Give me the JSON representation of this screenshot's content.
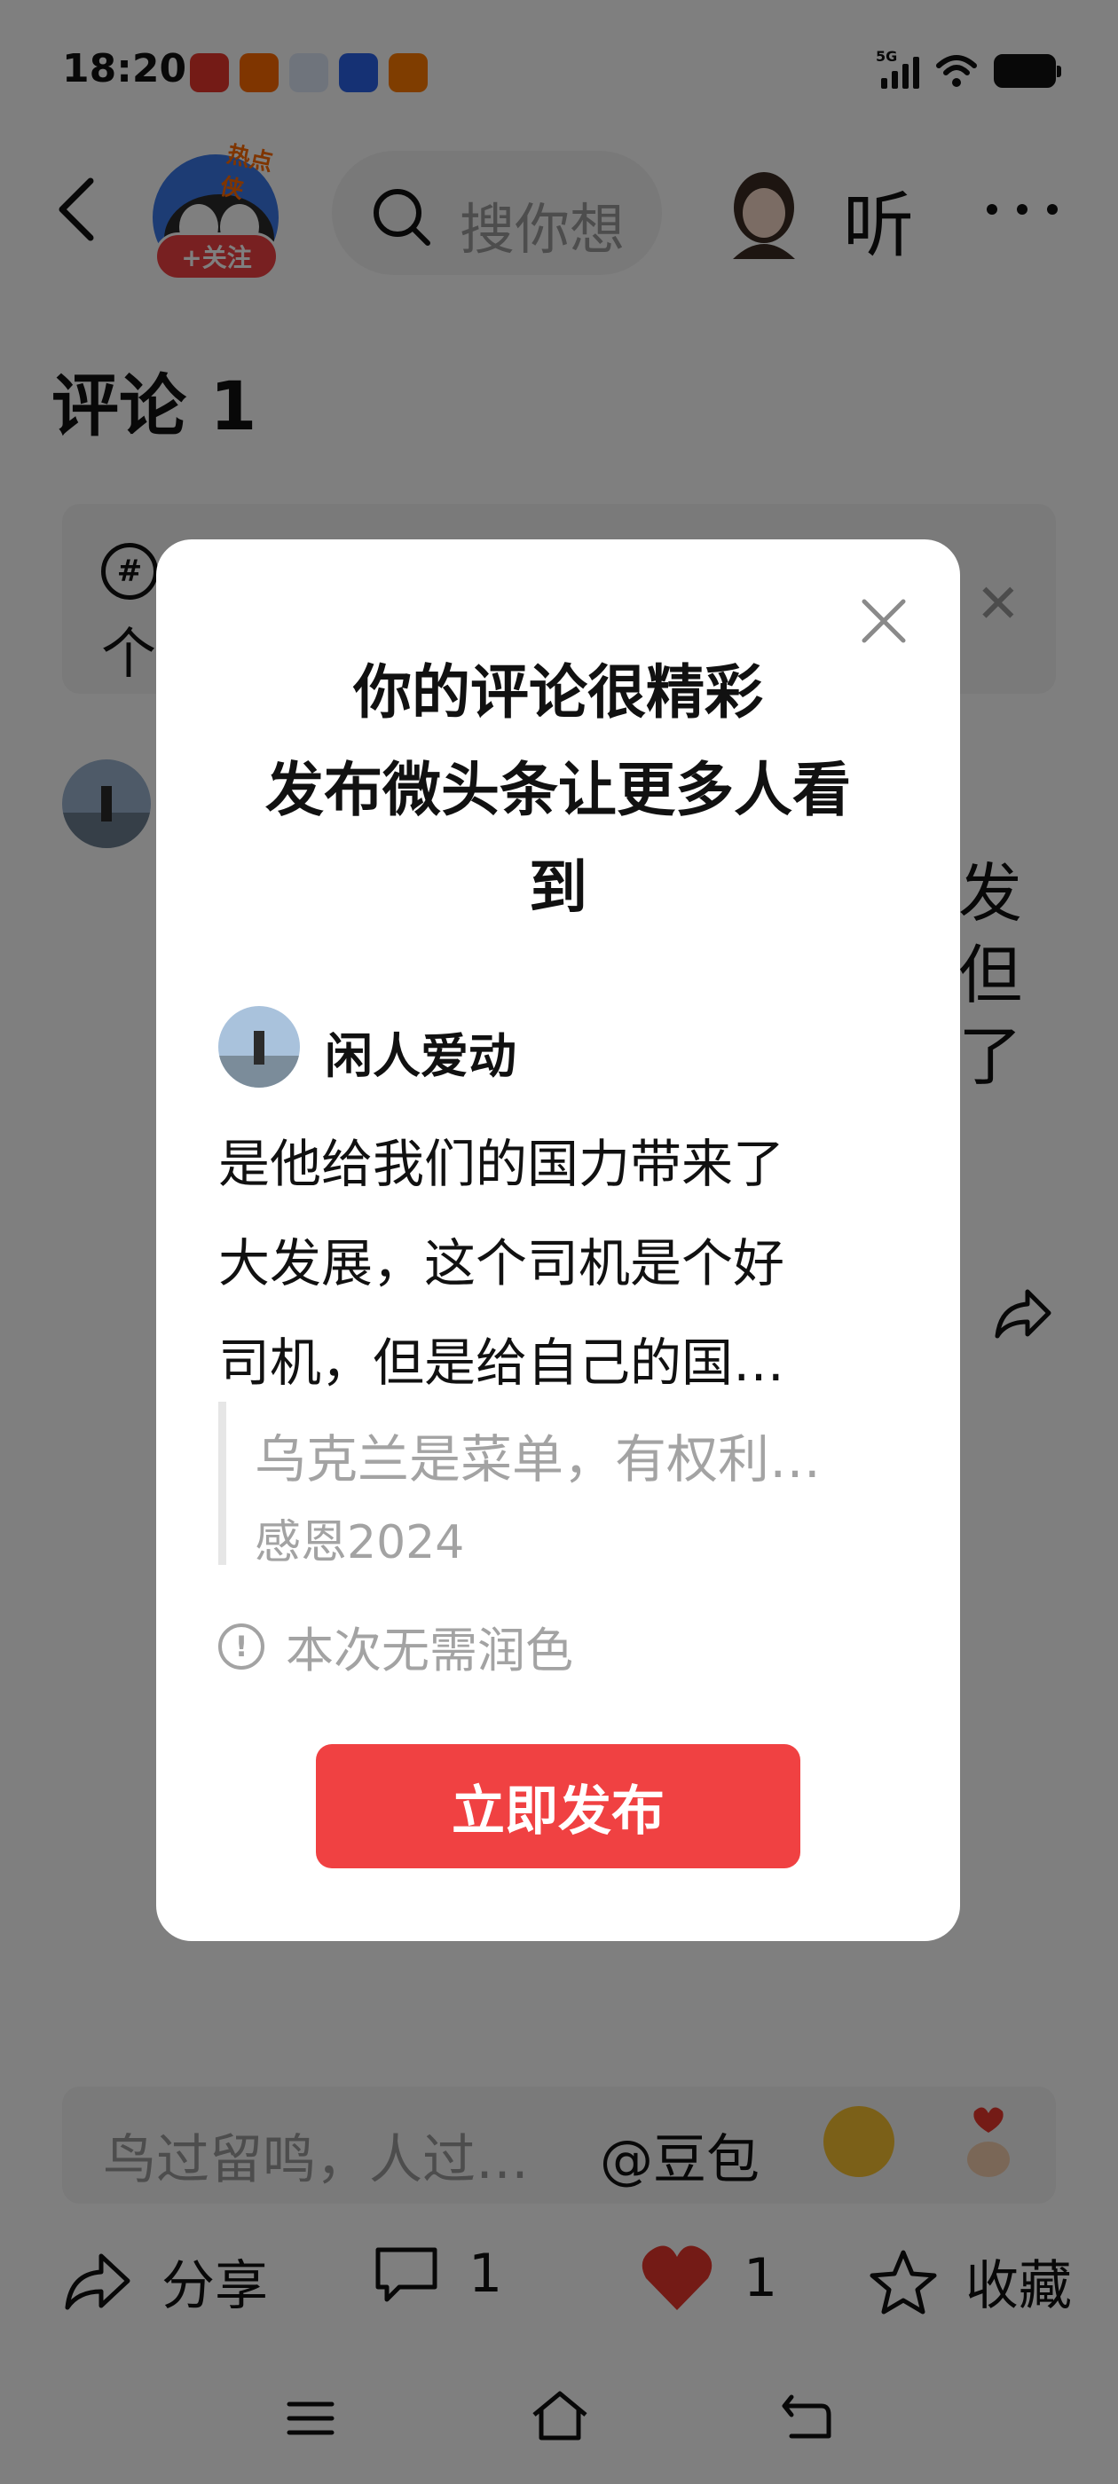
{
  "status_bar": {
    "time": "18:20",
    "network": "5G",
    "apps": [
      {
        "name": "头条",
        "color": "#e8372c"
      },
      {
        "name": "快手",
        "color": "#ff6a00"
      },
      {
        "name": "头像",
        "color": "#3b82f6"
      },
      {
        "name": "百度",
        "color": "#2b62e8"
      },
      {
        "name": "小游戏",
        "color": "#ff7a00"
      }
    ]
  },
  "header": {
    "follow_label": "+关注",
    "hot_tag": "热点侠",
    "search_placeholder": "搜你想",
    "listen_label": "听"
  },
  "comments_title": "评论 1",
  "topic_card": {
    "line2": "个"
  },
  "comment_side_chars": [
    "发",
    "但",
    "了"
  ],
  "modal": {
    "title_line1": "你的评论很精彩",
    "title_line2": "发布微头条让更多人看",
    "title_line3": "到",
    "user_name": "闲人爱动",
    "body_line1": "是他给我们的国力带来了",
    "body_line2": "大发展，这个司机是个好",
    "body_line3": "司机，但是给自己的国…",
    "quote_text": "乌克兰是菜单，有权利…",
    "quote_author": "感恩2024",
    "notice": "本次无需润色",
    "publish_label": "立即发布"
  },
  "input_bar": {
    "placeholder": "鸟过留鸣，人过…",
    "doubao": "@豆包"
  },
  "bottom_actions": {
    "share_label": "分享",
    "comment_count": "1",
    "like_count": "1",
    "favorite_label": "收藏"
  },
  "colors": {
    "accent_red": "#f04142",
    "overlay": "rgba(0,0,0,0.5)"
  }
}
